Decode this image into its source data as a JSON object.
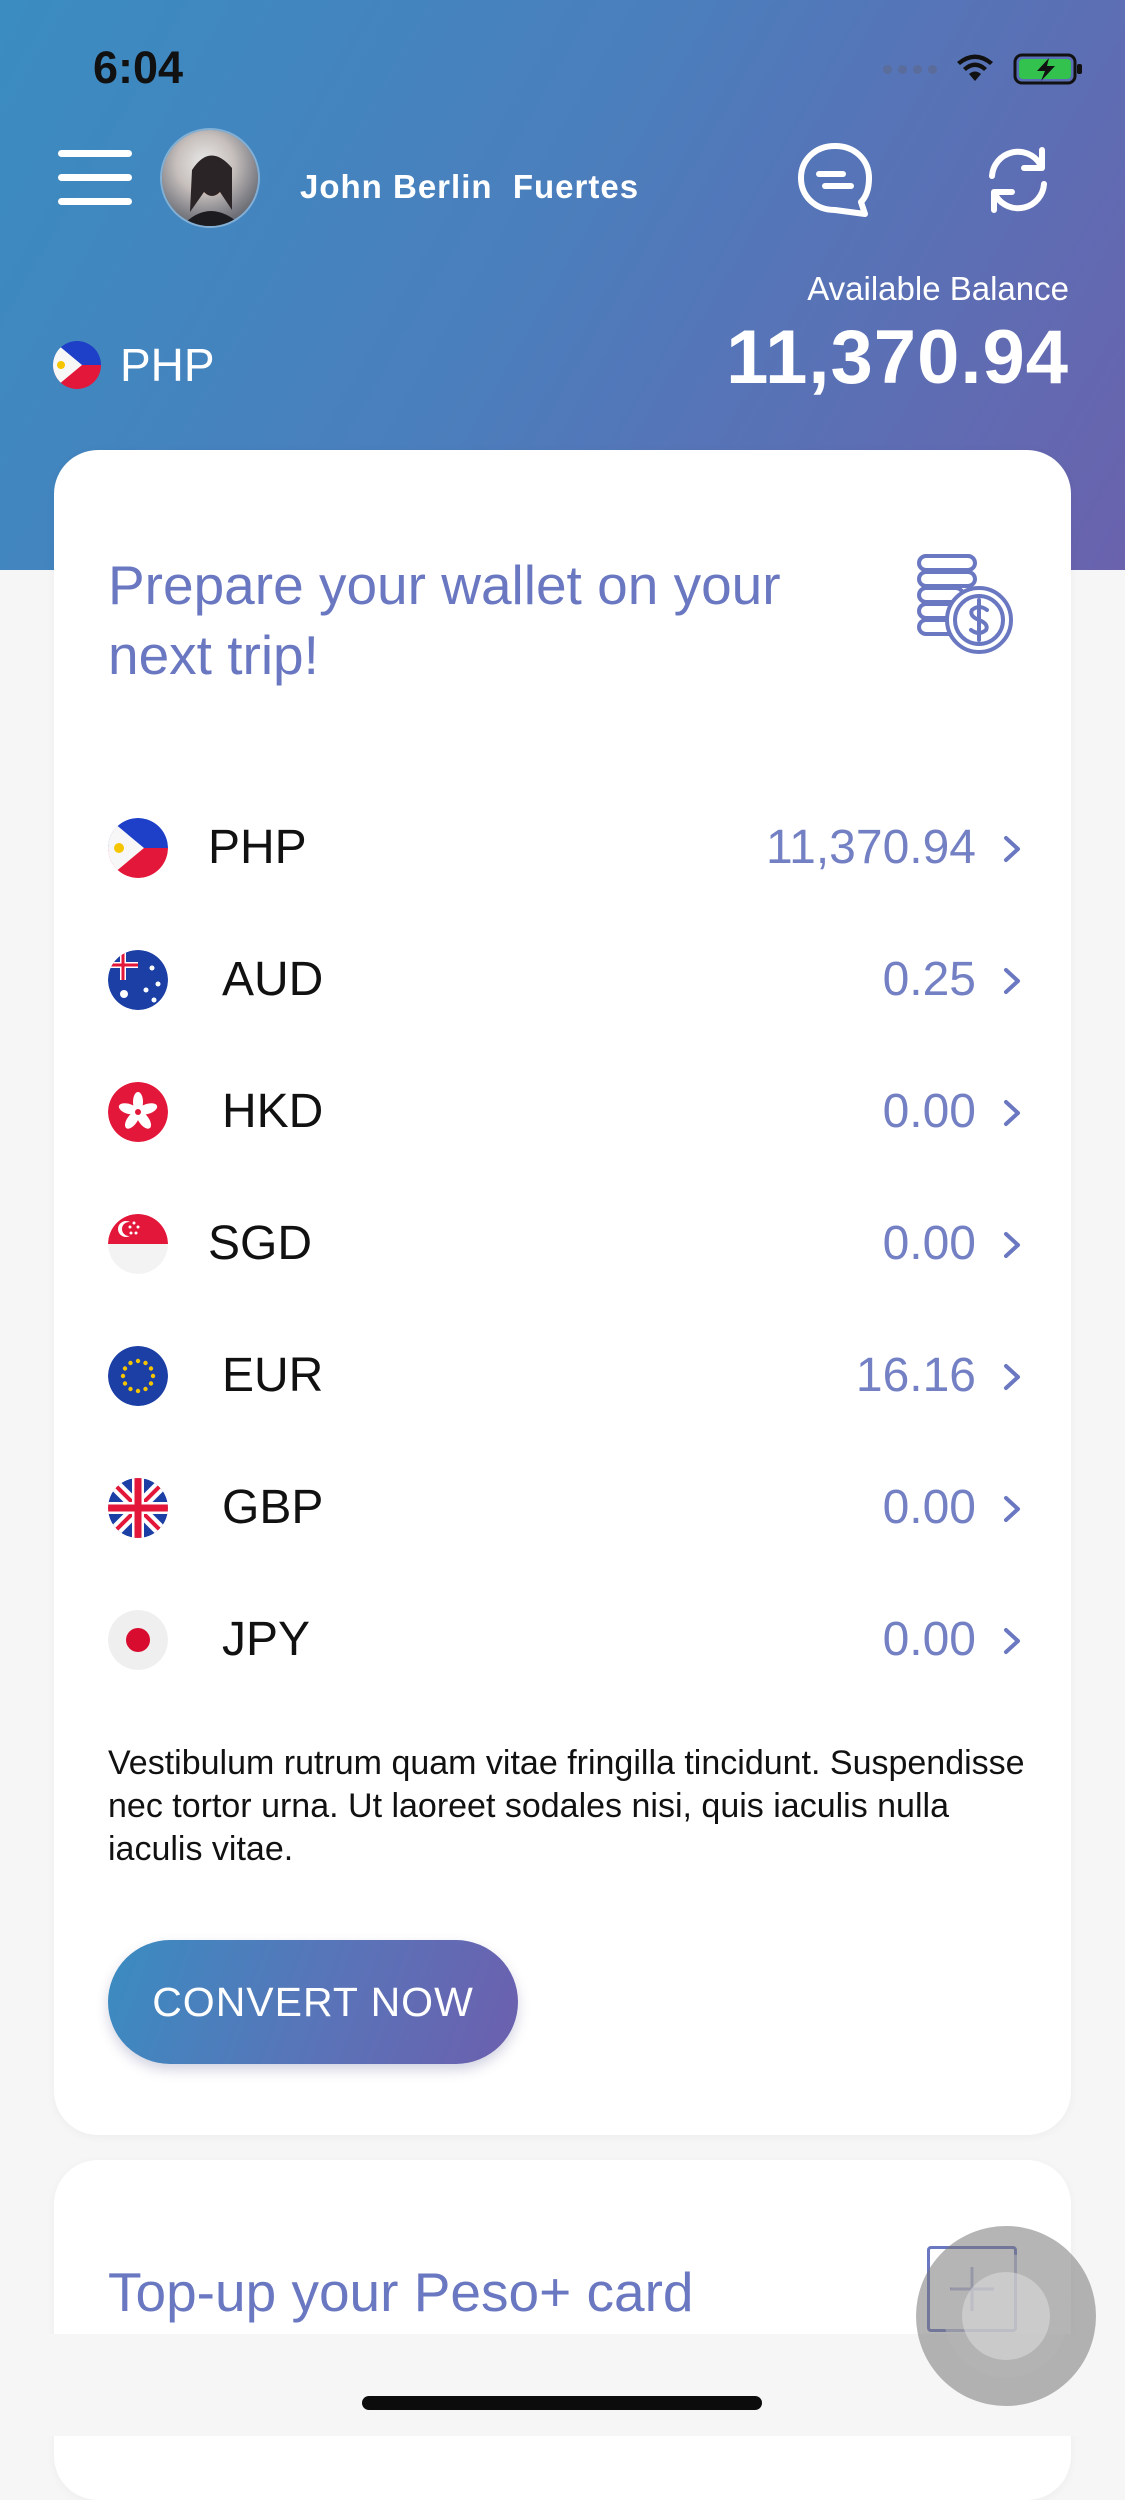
{
  "status_bar": {
    "time": "6:04"
  },
  "header": {
    "user_name": "John Berlin  Fuertes",
    "currency_code": "PHP",
    "balance_label": "Available Balance",
    "balance_amount": "11,370.94",
    "menu_icon": "hamburger-menu-icon",
    "chat_icon": "chat-bubble-icon",
    "refresh_icon": "refresh-icon"
  },
  "wallet_card": {
    "title": "Prepare your wallet on your next trip!",
    "icon": "coins-dollar-icon",
    "currencies": [
      {
        "code": "PHP",
        "amount": "11,370.94",
        "flag": "philippines-flag-icon"
      },
      {
        "code": "AUD",
        "amount": "0.25",
        "flag": "australia-flag-icon"
      },
      {
        "code": "HKD",
        "amount": "0.00",
        "flag": "hong-kong-flag-icon"
      },
      {
        "code": "SGD",
        "amount": "0.00",
        "flag": "singapore-flag-icon"
      },
      {
        "code": "EUR",
        "amount": "16.16",
        "flag": "eu-flag-icon"
      },
      {
        "code": "GBP",
        "amount": "0.00",
        "flag": "uk-flag-icon"
      },
      {
        "code": "JPY",
        "amount": "0.00",
        "flag": "japan-flag-icon"
      }
    ],
    "description": "Vestibulum rutrum quam vitae fringilla tincidunt. Suspendisse nec tortor urna. Ut laoreet sodales nisi, quis iaculis nulla iaculis vitae.",
    "convert_button_label": "CONVERT NOW"
  },
  "topup_card": {
    "title": "Top-up your Peso+ card",
    "icon": "plus-box-icon"
  },
  "colors": {
    "header_gradient_start": "#3a8cc1",
    "header_gradient_end": "#6a62ad",
    "accent_text": "#6a77c1",
    "amount_text": "#7480c4"
  }
}
